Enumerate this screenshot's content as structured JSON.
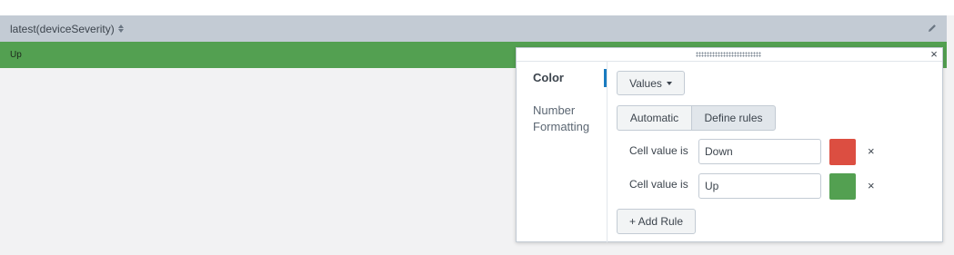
{
  "table": {
    "column_header": "latest(deviceSeverity)",
    "row_value": "Up",
    "row_color": "#53a051"
  },
  "panel": {
    "sidebar": {
      "color_label": "Color",
      "number_line1": "Number",
      "number_line2": "Formatting"
    },
    "values_button": "Values",
    "mode_automatic": "Automatic",
    "mode_define_rules": "Define rules",
    "rules": [
      {
        "label": "Cell value is",
        "value": "Down",
        "color": "#dc4e41"
      },
      {
        "label": "Cell value is",
        "value": "Up",
        "color": "#53a051"
      }
    ],
    "remove_glyph": "×",
    "close_glyph": "×",
    "add_rule_label": "+ Add Rule"
  }
}
